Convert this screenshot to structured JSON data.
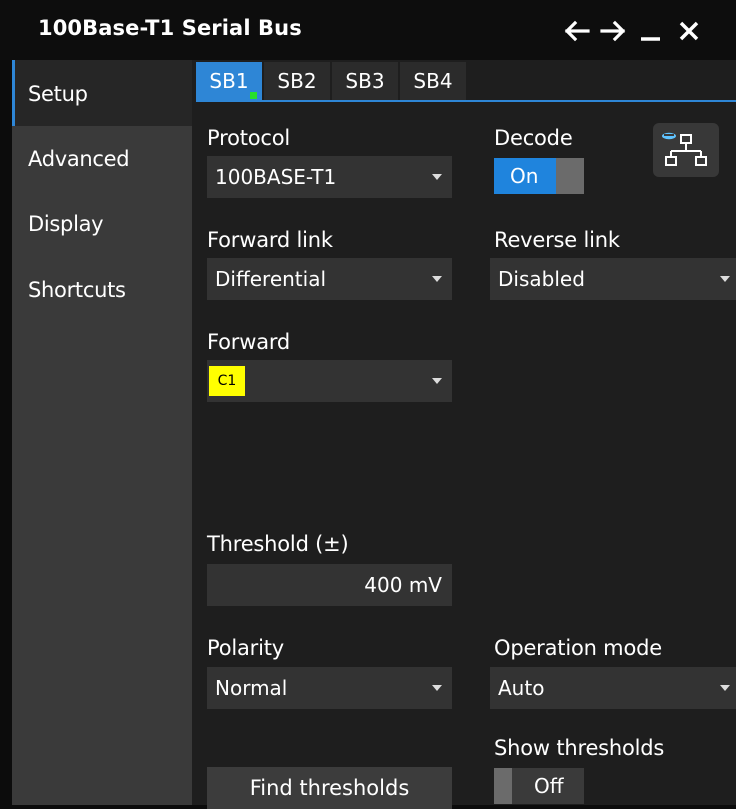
{
  "window": {
    "title": "100Base-T1 Serial Bus",
    "icons": [
      "back-arrow-icon",
      "forward-arrow-icon",
      "minimize-icon",
      "close-icon"
    ]
  },
  "sidebar": {
    "items": [
      {
        "label": "Setup",
        "active": true
      },
      {
        "label": "Advanced",
        "active": false
      },
      {
        "label": "Display",
        "active": false
      },
      {
        "label": "Shortcuts",
        "active": false
      }
    ]
  },
  "tabs": [
    {
      "label": "SB1",
      "active": true
    },
    {
      "label": "SB2",
      "active": false
    },
    {
      "label": "SB3",
      "active": false
    },
    {
      "label": "SB4",
      "active": false
    }
  ],
  "protocol": {
    "label": "Protocol",
    "value": "100BASE-T1"
  },
  "decode": {
    "label": "Decode",
    "value": "On"
  },
  "forward_link": {
    "label": "Forward link",
    "value": "Differential"
  },
  "reverse_link": {
    "label": "Reverse link",
    "value": "Disabled"
  },
  "forward": {
    "label": "Forward",
    "source": "C1"
  },
  "threshold": {
    "label": "Threshold (±)",
    "value": "400 mV"
  },
  "polarity": {
    "label": "Polarity",
    "value": "Normal"
  },
  "operation_mode": {
    "label": "Operation mode",
    "value": "Auto"
  },
  "show_thresholds": {
    "label": "Show thresholds",
    "value": "Off"
  },
  "find_thresholds": {
    "label": "Find thresholds"
  },
  "colors": {
    "accent": "#2e86d6",
    "toggle_on": "#1f84dd",
    "channel_chip": "#ffff00",
    "active_indicator": "#27e02d"
  }
}
